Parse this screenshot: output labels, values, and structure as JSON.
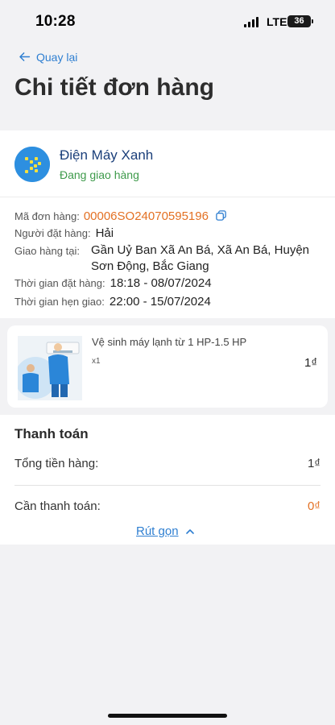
{
  "status_bar": {
    "time": "10:28",
    "network": "LTE",
    "battery": "36"
  },
  "header": {
    "back_label": "Quay lại",
    "title": "Chi tiết đơn hàng"
  },
  "store": {
    "name": "Điện Máy Xanh",
    "status": "Đang giao hàng"
  },
  "order": {
    "code_label": "Mã đơn hàng:",
    "code": "00006SO24070595196",
    "customer_label": "Người đặt hàng:",
    "customer": "Hải",
    "address_label": "Giao hàng tại:",
    "address": "Gần Uỷ Ban Xã An Bá, Xã An Bá, Huyện Sơn Động, Bắc Giang",
    "order_time_label": "Thời gian đặt hàng:",
    "order_time": "18:18 - 08/07/2024",
    "delivery_time_label": "Thời gian hẹn giao:",
    "delivery_time": "22:00 - 15/07/2024"
  },
  "product": {
    "name": "Vệ sinh máy lạnh từ 1 HP-1.5 HP",
    "quantity": "x1",
    "price": "1₫"
  },
  "payment": {
    "title": "Thanh toán",
    "subtotal_label": "Tổng tiền hàng:",
    "subtotal": "1₫",
    "due_label": "Cần thanh toán:",
    "due": "0₫",
    "collapse_label": "Rút gọn"
  },
  "colors": {
    "accent_blue": "#2f7fd1",
    "orange": "#e37023",
    "green": "#3e9a4b",
    "store_blue": "#1b3f7a"
  }
}
